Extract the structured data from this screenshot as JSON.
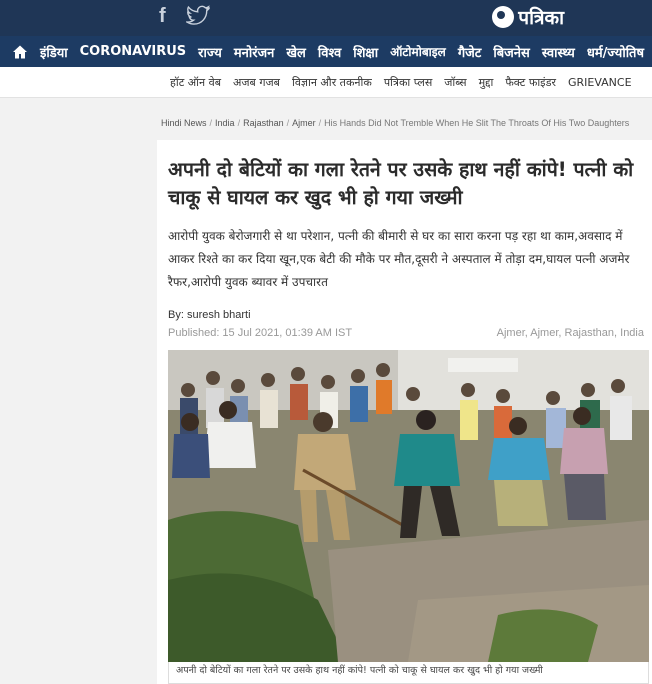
{
  "header": {
    "brand": "पत्रिका",
    "social": [
      "facebook-icon",
      "twitter-icon"
    ]
  },
  "nav": {
    "main": [
      "इंडिया",
      "CORONAVIRUS",
      "राज्य",
      "मनोरंजन",
      "खेल",
      "विश्व",
      "शिक्षा",
      "ऑटोमोबाइल",
      "गैजेट",
      "बिजनेस",
      "स्वास्थ्य",
      "धर्म/ज्योतिष"
    ],
    "sub": [
      "हॉट ऑन वेब",
      "अजब गजब",
      "विज्ञान और तकनीक",
      "पत्रिका प्लस",
      "जॉब्स",
      "मुद्दा",
      "फैक्ट फाइंडर",
      "GRIEVANCE"
    ]
  },
  "breadcrumb": [
    "Hindi News",
    "India",
    "Rajasthan",
    "Ajmer",
    "His Hands Did Not Tremble When He Slit The Throats Of His Two Daughters"
  ],
  "article": {
    "title": "अपनी दो बेटियों का गला रेतने पर उसके हाथ नहीं कांपे! पत्नी को चाकू से घायल कर खुद भी हो गया जख्मी",
    "summary": "आरोपी युवक बेरोजगारी से था परेशान, पत्नी की बीमारी से घर का सारा करना पड़ रहा था काम,अवसाद में आकर रिश्ते का कर दिया खून,एक बेटी की मौके पर मौत,दूसरी ने अस्पताल में तोड़ा दम,घायल पत्नी अजमेर रैफर,आरोपी युवक ब्यावर में उपचारत",
    "byline": "By: suresh bharti",
    "published": "Published: 15 Jul 2021, 01:39 AM IST",
    "location": "Ajmer, Ajmer, Rajasthan, India",
    "caption": "अपनी दो बेटियों का गला रेतने पर उसके हाथ नहीं कांपे! पत्नी को चाकू से घायल कर खुद भी हो गया जख्मी"
  },
  "colors": {
    "topbar": "#1f3656",
    "nav": "#1d3b63"
  }
}
